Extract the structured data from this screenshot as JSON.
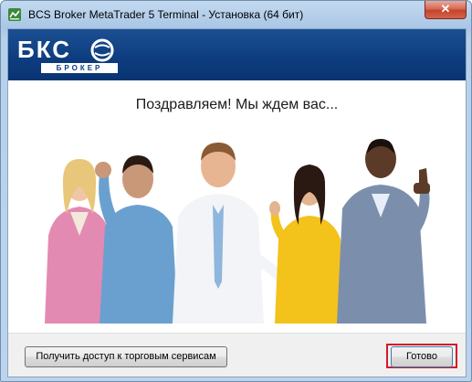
{
  "window": {
    "title": "BCS Broker MetaTrader 5 Terminal - Установка (64 бит)",
    "close_label": "✕"
  },
  "banner": {
    "logo_text": "БКС",
    "logo_sub": "БРОКЕР"
  },
  "main": {
    "headline": "Поздравляем! Мы ждем вас..."
  },
  "footer": {
    "access_button": "Получить доступ к торговым сервисам",
    "done_button": "Готово"
  },
  "colors": {
    "banner": "#0d3c7e",
    "highlight": "#d51b25"
  }
}
